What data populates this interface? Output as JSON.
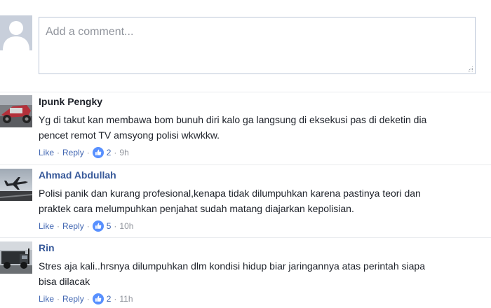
{
  "composer": {
    "placeholder": "Add a comment..."
  },
  "comments": [
    {
      "author": "Ipunk Pengky",
      "lines": [
        "Yg di takut kan membawa bom bunuh diri kalo ga langsung di eksekusi pas di deketin dia",
        "pencet remot TV amsyong polisi wkwkkw."
      ],
      "like_label": "Like",
      "reply_label": "Reply",
      "reaction_count": "2",
      "time": "9h"
    },
    {
      "author": "Ahmad Abdullah",
      "lines": [
        "Polisi panik dan kurang profesional,kenapa tidak dilumpuhkan karena pastinya teori dan",
        "praktek cara melumpuhkan penjahat sudah matang diajarkan kepolisian."
      ],
      "like_label": "Like",
      "reply_label": "Reply",
      "reaction_count": "5",
      "time": "10h"
    },
    {
      "author": "Rin",
      "lines": [
        "Stres aja kali..hrsnya dilumpuhkan dlm kondisi hidup biar jaringannya atas perintah siapa",
        "bisa dilacak"
      ],
      "like_label": "Like",
      "reply_label": "Reply",
      "reaction_count": "2",
      "time": "11h"
    }
  ],
  "colors": {
    "link": "#4267b2",
    "author_blue": "#365899",
    "meta_gray": "#90949c"
  }
}
